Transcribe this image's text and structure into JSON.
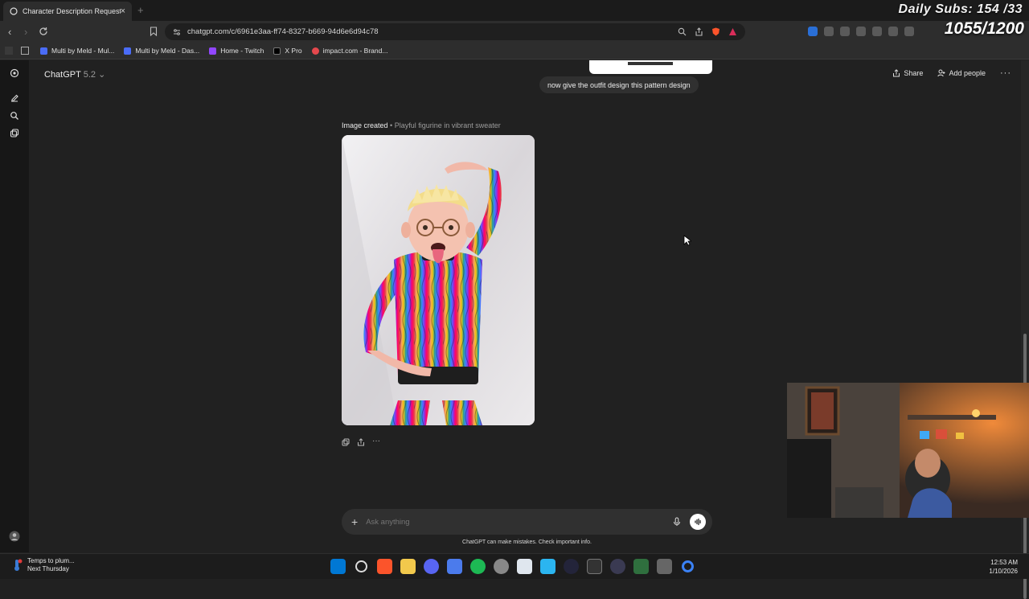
{
  "browser": {
    "tab_title": "Character Description Request",
    "url": "chatgpt.com/c/6961e3aa-ff74-8327-b669-94d6e6d94c78",
    "bookmarks": [
      "Multi by Meld - Mul...",
      "Multi by Meld - Das...",
      "Home - Twitch",
      "X Pro",
      "impact.com - Brand..."
    ]
  },
  "stream_overlay": {
    "daily_subs": "Daily Subs: 154 /33",
    "goal": "1055/1200"
  },
  "chat": {
    "model": "ChatGPT",
    "model_version": "5.2",
    "share_label": "Share",
    "add_people_label": "Add people",
    "user_message": "now give the outfit design this pattern design",
    "image_caption_title": "Image created",
    "image_caption_sep": " • ",
    "image_caption_sub": "Playful figurine in vibrant sweater",
    "composer_placeholder": "Ask anything",
    "disclaimer": "ChatGPT can make mistakes. Check important info."
  },
  "taskbar": {
    "weather_line1": "Temps to plum...",
    "weather_line2": "Next Thursday",
    "time": "12:53 AM",
    "date": "1/10/2026",
    "apps": [
      "windows-start",
      "search",
      "brave",
      "file-explorer",
      "discord",
      "app-blue",
      "spotify",
      "chrome",
      "app-window",
      "app-store",
      "app-dark",
      "terminal",
      "app-circle",
      "app-green",
      "app-gray",
      "app-c"
    ]
  },
  "colors": {
    "page_bg": "#212121",
    "rail_bg": "#171717",
    "bubble_bg": "#303030",
    "brave_orange": "#fb542b",
    "spotify_green": "#1db954"
  }
}
